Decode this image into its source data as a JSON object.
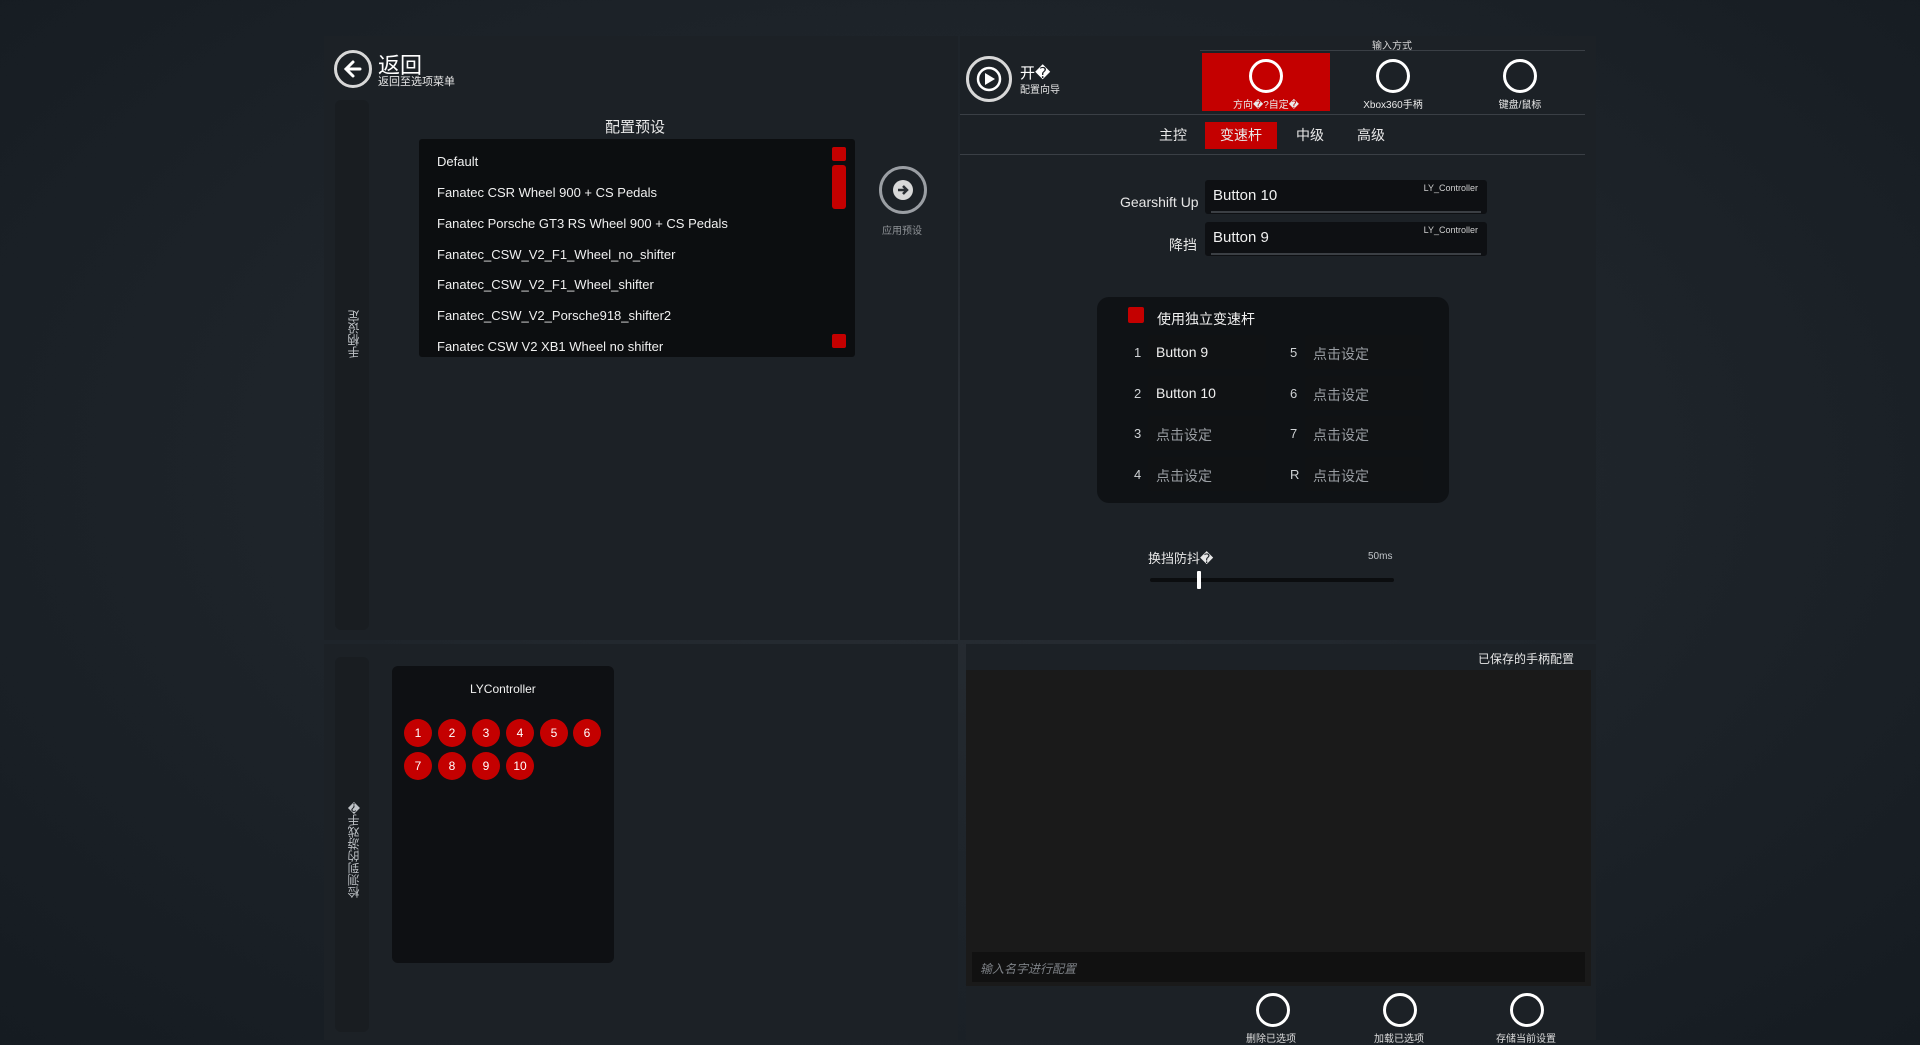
{
  "back": {
    "title": "返回",
    "subtitle": "返回至选项菜单"
  },
  "left_sidebar_label": "手柄设定",
  "presets": {
    "title": "配置预设",
    "items": [
      "Default",
      "Fanatec CSR Wheel 900 + CS Pedals",
      "Fanatec Porsche GT3 RS Wheel 900 + CS Pedals",
      "Fanatec_CSW_V2_F1_Wheel_no_shifter",
      "Fanatec_CSW_V2_F1_Wheel_shifter",
      "Fanatec_CSW_V2_Porsche918_shifter2",
      "Fanatec CSW V2 XB1 Wheel no shifter"
    ],
    "apply_label": "应用预设"
  },
  "wizard": {
    "title": "开�",
    "subtitle": "配置向导"
  },
  "input_mode": {
    "label": "输入方式",
    "options": [
      {
        "label": "方向�?自定�",
        "icon": "steering-wheel-icon",
        "active": true
      },
      {
        "label": "Xbox360手柄",
        "icon": "gamepad-icon",
        "active": false
      },
      {
        "label": "键盘/鼠标",
        "icon": "keyboard-mouse-icon",
        "active": false
      }
    ]
  },
  "tabs": [
    {
      "label": "主控",
      "active": false
    },
    {
      "label": "变速杆",
      "active": true
    },
    {
      "label": "中级",
      "active": false
    },
    {
      "label": "高级",
      "active": false
    }
  ],
  "gearshift": {
    "up_label": "Gearshift Up",
    "up_value": "Button 10",
    "up_device": "LY_Controller",
    "down_label": "降挡",
    "down_value": "Button 9",
    "down_device": "LY_Controller"
  },
  "shifter": {
    "checkbox_label": "使用独立变速杆",
    "gears": [
      {
        "num": "1",
        "value": "Button 9"
      },
      {
        "num": "2",
        "value": "Button 10"
      },
      {
        "num": "3",
        "value": "点击设定"
      },
      {
        "num": "4",
        "value": "点击设定"
      },
      {
        "num": "5",
        "value": "点击设定"
      },
      {
        "num": "6",
        "value": "点击设定"
      },
      {
        "num": "7",
        "value": "点击设定"
      },
      {
        "num": "R",
        "value": "点击设定"
      }
    ]
  },
  "debounce": {
    "label": "换挡防抖�",
    "value": "50ms",
    "fraction": 0.2
  },
  "controller": {
    "sidebar_label": "检测到的游戏手�",
    "name": "LYController",
    "buttons": [
      "1",
      "2",
      "3",
      "4",
      "5",
      "6",
      "7",
      "8",
      "9",
      "10"
    ]
  },
  "saved": {
    "title": "已保存的手柄配置",
    "name_placeholder": "输入名字进行配置",
    "actions": [
      {
        "label": "删除已选项",
        "icon": "delete-icon"
      },
      {
        "label": "加载已选项",
        "icon": "load-icon"
      },
      {
        "label": "存储当前设置",
        "icon": "save-icon"
      }
    ]
  },
  "colors": {
    "accent": "#c40000",
    "panel": "#1c2126",
    "field": "#0e1013"
  }
}
